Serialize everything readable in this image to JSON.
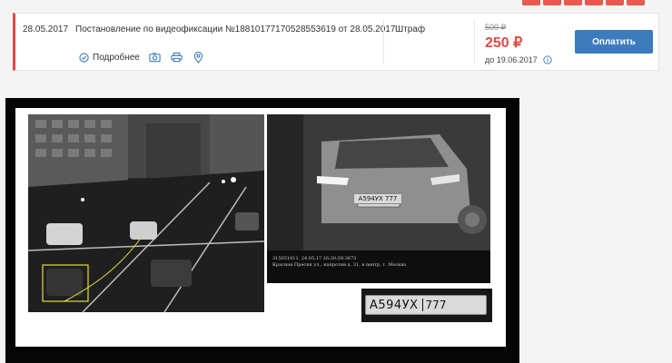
{
  "fine": {
    "date": "28.05.2017",
    "title": "Постановление по видеофиксации №18810177170528553619 от 28.05.2017",
    "more_label": "Подробнее",
    "type": "Штраф",
    "old_price": "500 ₽",
    "new_price": "250 ₽",
    "deadline": "до 19.06.2017",
    "pay_label": "Оплатить"
  },
  "evidence": {
    "caption_line1": "315051011, 24.05.17 26:20:59.3673",
    "caption_line2": "Красная Пресня ул., напротив д. 31, в центр, г. Москва",
    "plate_number": "А594УХ",
    "plate_region": "777",
    "small_plate": "А594УХ 777"
  },
  "colors": {
    "accent_red": "#e24b45",
    "pay_blue": "#3d7bbf"
  },
  "icons": [
    "info-circle-icon",
    "camera-icon",
    "printer-icon",
    "map-pin-icon"
  ]
}
